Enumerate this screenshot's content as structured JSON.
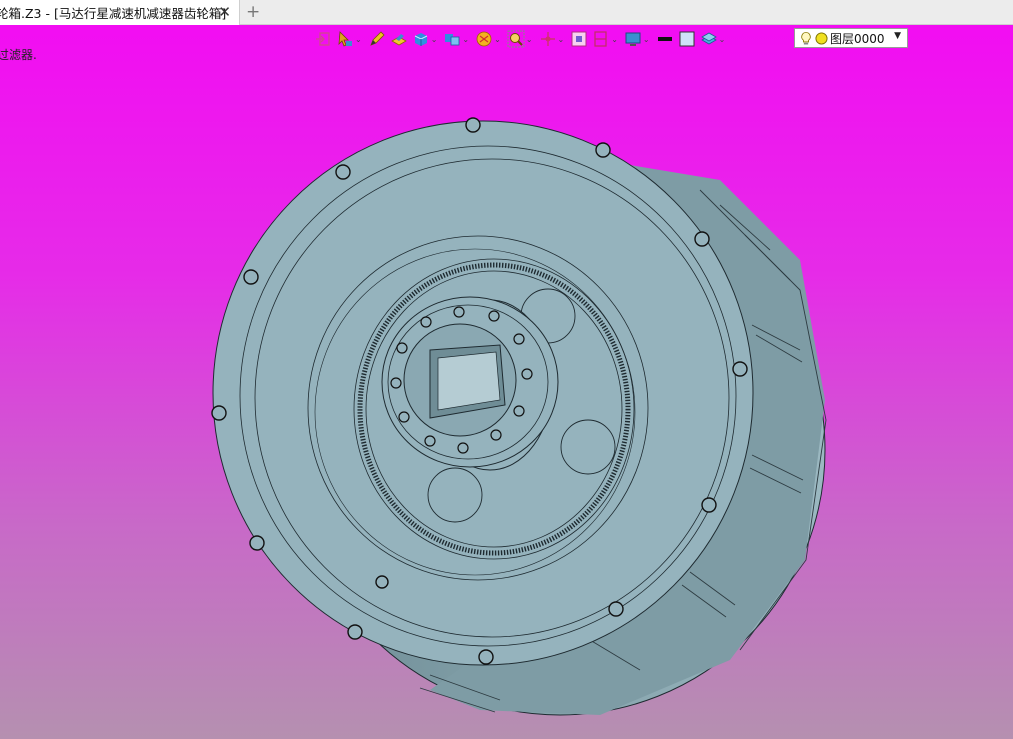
{
  "tab": {
    "title": "轮箱.Z3 - [马达行星减速机减速器齿轮箱]",
    "close": "✕",
    "new_tab": "+"
  },
  "status": {
    "hint": "过滤器."
  },
  "layer": {
    "name": "图层0000"
  },
  "colors": {
    "bg_top": "#f20df2",
    "bg_bottom": "#b590b0",
    "part": "#95b3bd",
    "edge": "#1e2a30"
  },
  "icons": [
    "exit-icon",
    "select-icon",
    "pencil-icon",
    "sketch-icon",
    "solid-icon",
    "face-icon",
    "display-icon",
    "search-zoom-icon",
    "origin-icon",
    "view-icon",
    "section-icon",
    "monitor-icon",
    "line-color-icon",
    "fill-color-icon",
    "layer-icon",
    "bulb-icon"
  ]
}
